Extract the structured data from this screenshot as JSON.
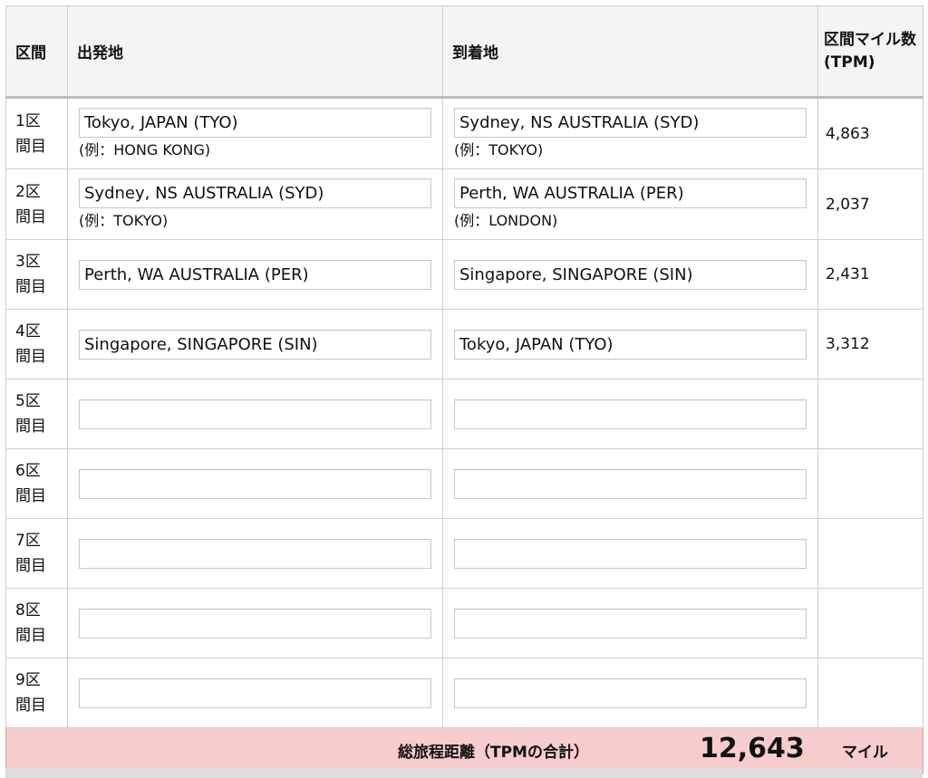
{
  "headers": {
    "segment": "区間",
    "origin": "出発地",
    "destination": "到着地",
    "miles": "区間マイル数(TPM)"
  },
  "rows": [
    {
      "idx_num": "1区",
      "idx_suffix": "間目",
      "origin": "Tokyo, JAPAN (TYO)",
      "origin_example": "(例：HONG KONG)",
      "dest": "Sydney, NS AUSTRALIA (SYD)",
      "dest_example": "(例：TOKYO)",
      "miles": "4,863"
    },
    {
      "idx_num": "2区",
      "idx_suffix": "間目",
      "origin": "Sydney, NS AUSTRALIA (SYD)",
      "origin_example": "(例：TOKYO)",
      "dest": "Perth, WA AUSTRALIA (PER)",
      "dest_example": "(例：LONDON)",
      "miles": "2,037"
    },
    {
      "idx_num": "3区",
      "idx_suffix": "間目",
      "origin": "Perth, WA AUSTRALIA (PER)",
      "origin_example": "",
      "dest": "Singapore, SINGAPORE (SIN)",
      "dest_example": "",
      "miles": "2,431"
    },
    {
      "idx_num": "4区",
      "idx_suffix": "間目",
      "origin": "Singapore, SINGAPORE (SIN)",
      "origin_example": "",
      "dest": "Tokyo, JAPAN (TYO)",
      "dest_example": "",
      "miles": "3,312"
    },
    {
      "idx_num": "5区",
      "idx_suffix": "間目",
      "origin": "",
      "origin_example": "",
      "dest": "",
      "dest_example": "",
      "miles": ""
    },
    {
      "idx_num": "6区",
      "idx_suffix": "間目",
      "origin": "",
      "origin_example": "",
      "dest": "",
      "dest_example": "",
      "miles": ""
    },
    {
      "idx_num": "7区",
      "idx_suffix": "間目",
      "origin": "",
      "origin_example": "",
      "dest": "",
      "dest_example": "",
      "miles": ""
    },
    {
      "idx_num": "8区",
      "idx_suffix": "間目",
      "origin": "",
      "origin_example": "",
      "dest": "",
      "dest_example": "",
      "miles": ""
    },
    {
      "idx_num": "9区",
      "idx_suffix": "間目",
      "origin": "",
      "origin_example": "",
      "dest": "",
      "dest_example": "",
      "miles": ""
    }
  ],
  "total": {
    "label": "総旅程距離（TPMの合計）",
    "value": "12,643",
    "unit": "マイル"
  },
  "colors": {
    "total_background": "#f6cccc",
    "header_background": "#f4f4f4"
  }
}
